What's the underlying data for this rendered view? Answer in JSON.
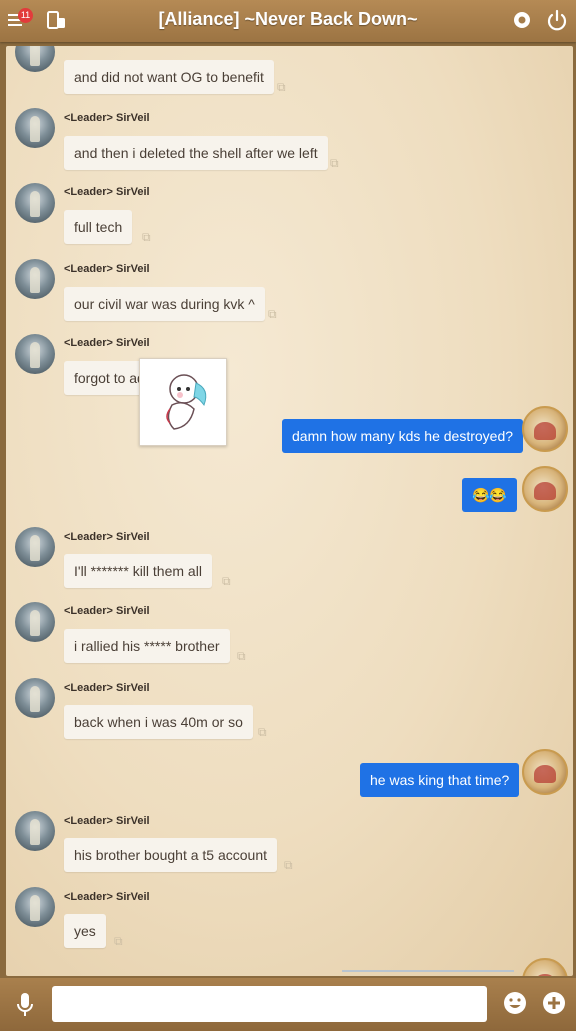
{
  "header": {
    "title": "[Alliance] ~Never Back Down~",
    "badge_count": "11",
    "icons": [
      "menu-icon",
      "switch-devices-icon",
      "settings-icon",
      "power-icon"
    ]
  },
  "sender_name": "<Leader> SirVeil",
  "messages": [
    {
      "type": "in",
      "text": "and did not want OG to benefit",
      "show_name": false
    },
    {
      "type": "in",
      "text": "and then i deleted the shell after we left",
      "show_name": true
    },
    {
      "type": "in",
      "text": "full tech",
      "show_name": true
    },
    {
      "type": "in",
      "text": "our civil war was during kvk ^",
      "show_name": true
    },
    {
      "type": "in",
      "text": "forgot to add",
      "show_name": true
    },
    {
      "type": "out",
      "text": "damn how many kds he destroyed?"
    },
    {
      "type": "out",
      "text": "😂😂"
    },
    {
      "type": "in",
      "text": "I'll ******* kill them all",
      "show_name": true
    },
    {
      "type": "in",
      "text": "i rallied his ***** brother",
      "show_name": true
    },
    {
      "type": "in",
      "text": "back when i was 40m or so",
      "show_name": true
    },
    {
      "type": "out",
      "text": "he was king that time?"
    },
    {
      "type": "in",
      "text": "his brother bought a t5 account",
      "show_name": true
    },
    {
      "type": "in",
      "text": "yes",
      "show_name": true
    }
  ],
  "composer": {
    "placeholder": "",
    "icons": [
      "microphone-icon",
      "emoji-icon",
      "add-icon"
    ]
  },
  "colors": {
    "accent": "#1f72e5",
    "header": "#a57d4b",
    "badge": "#e23b3b"
  }
}
